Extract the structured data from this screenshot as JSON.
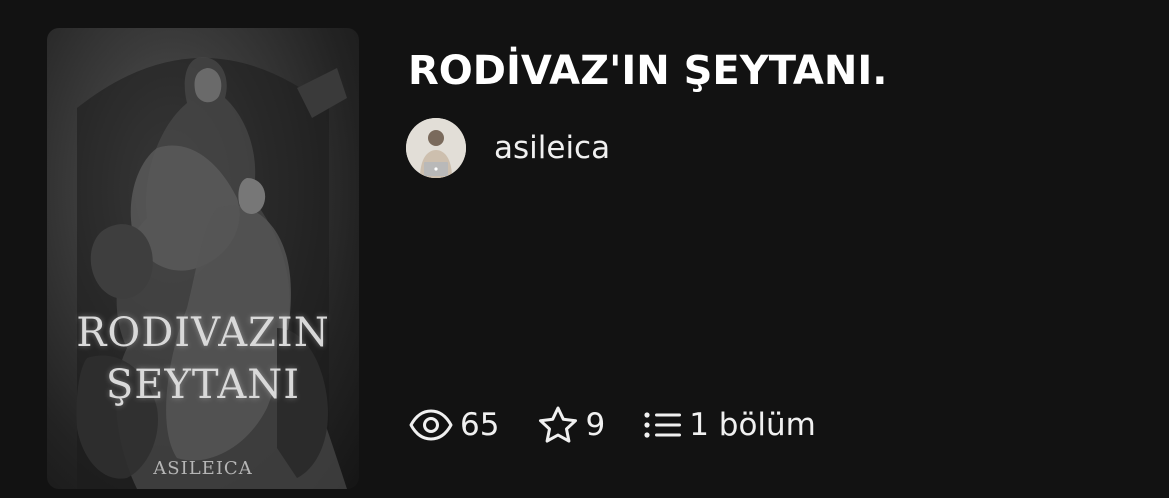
{
  "story": {
    "title": "RODİVAZ'IN ŞEYTANI.",
    "author": "asileica",
    "cover": {
      "title_line1": "RODIVAZIN",
      "title_line2": "ŞEYTANI",
      "author": "ASILEICA"
    }
  },
  "stats": {
    "reads": "65",
    "votes": "9",
    "parts": "1 bölüm"
  },
  "icons": {
    "reads": "eye-icon",
    "votes": "star-icon",
    "parts": "list-icon"
  },
  "colors": {
    "background": "#121212",
    "text": "#f2f2f2"
  }
}
